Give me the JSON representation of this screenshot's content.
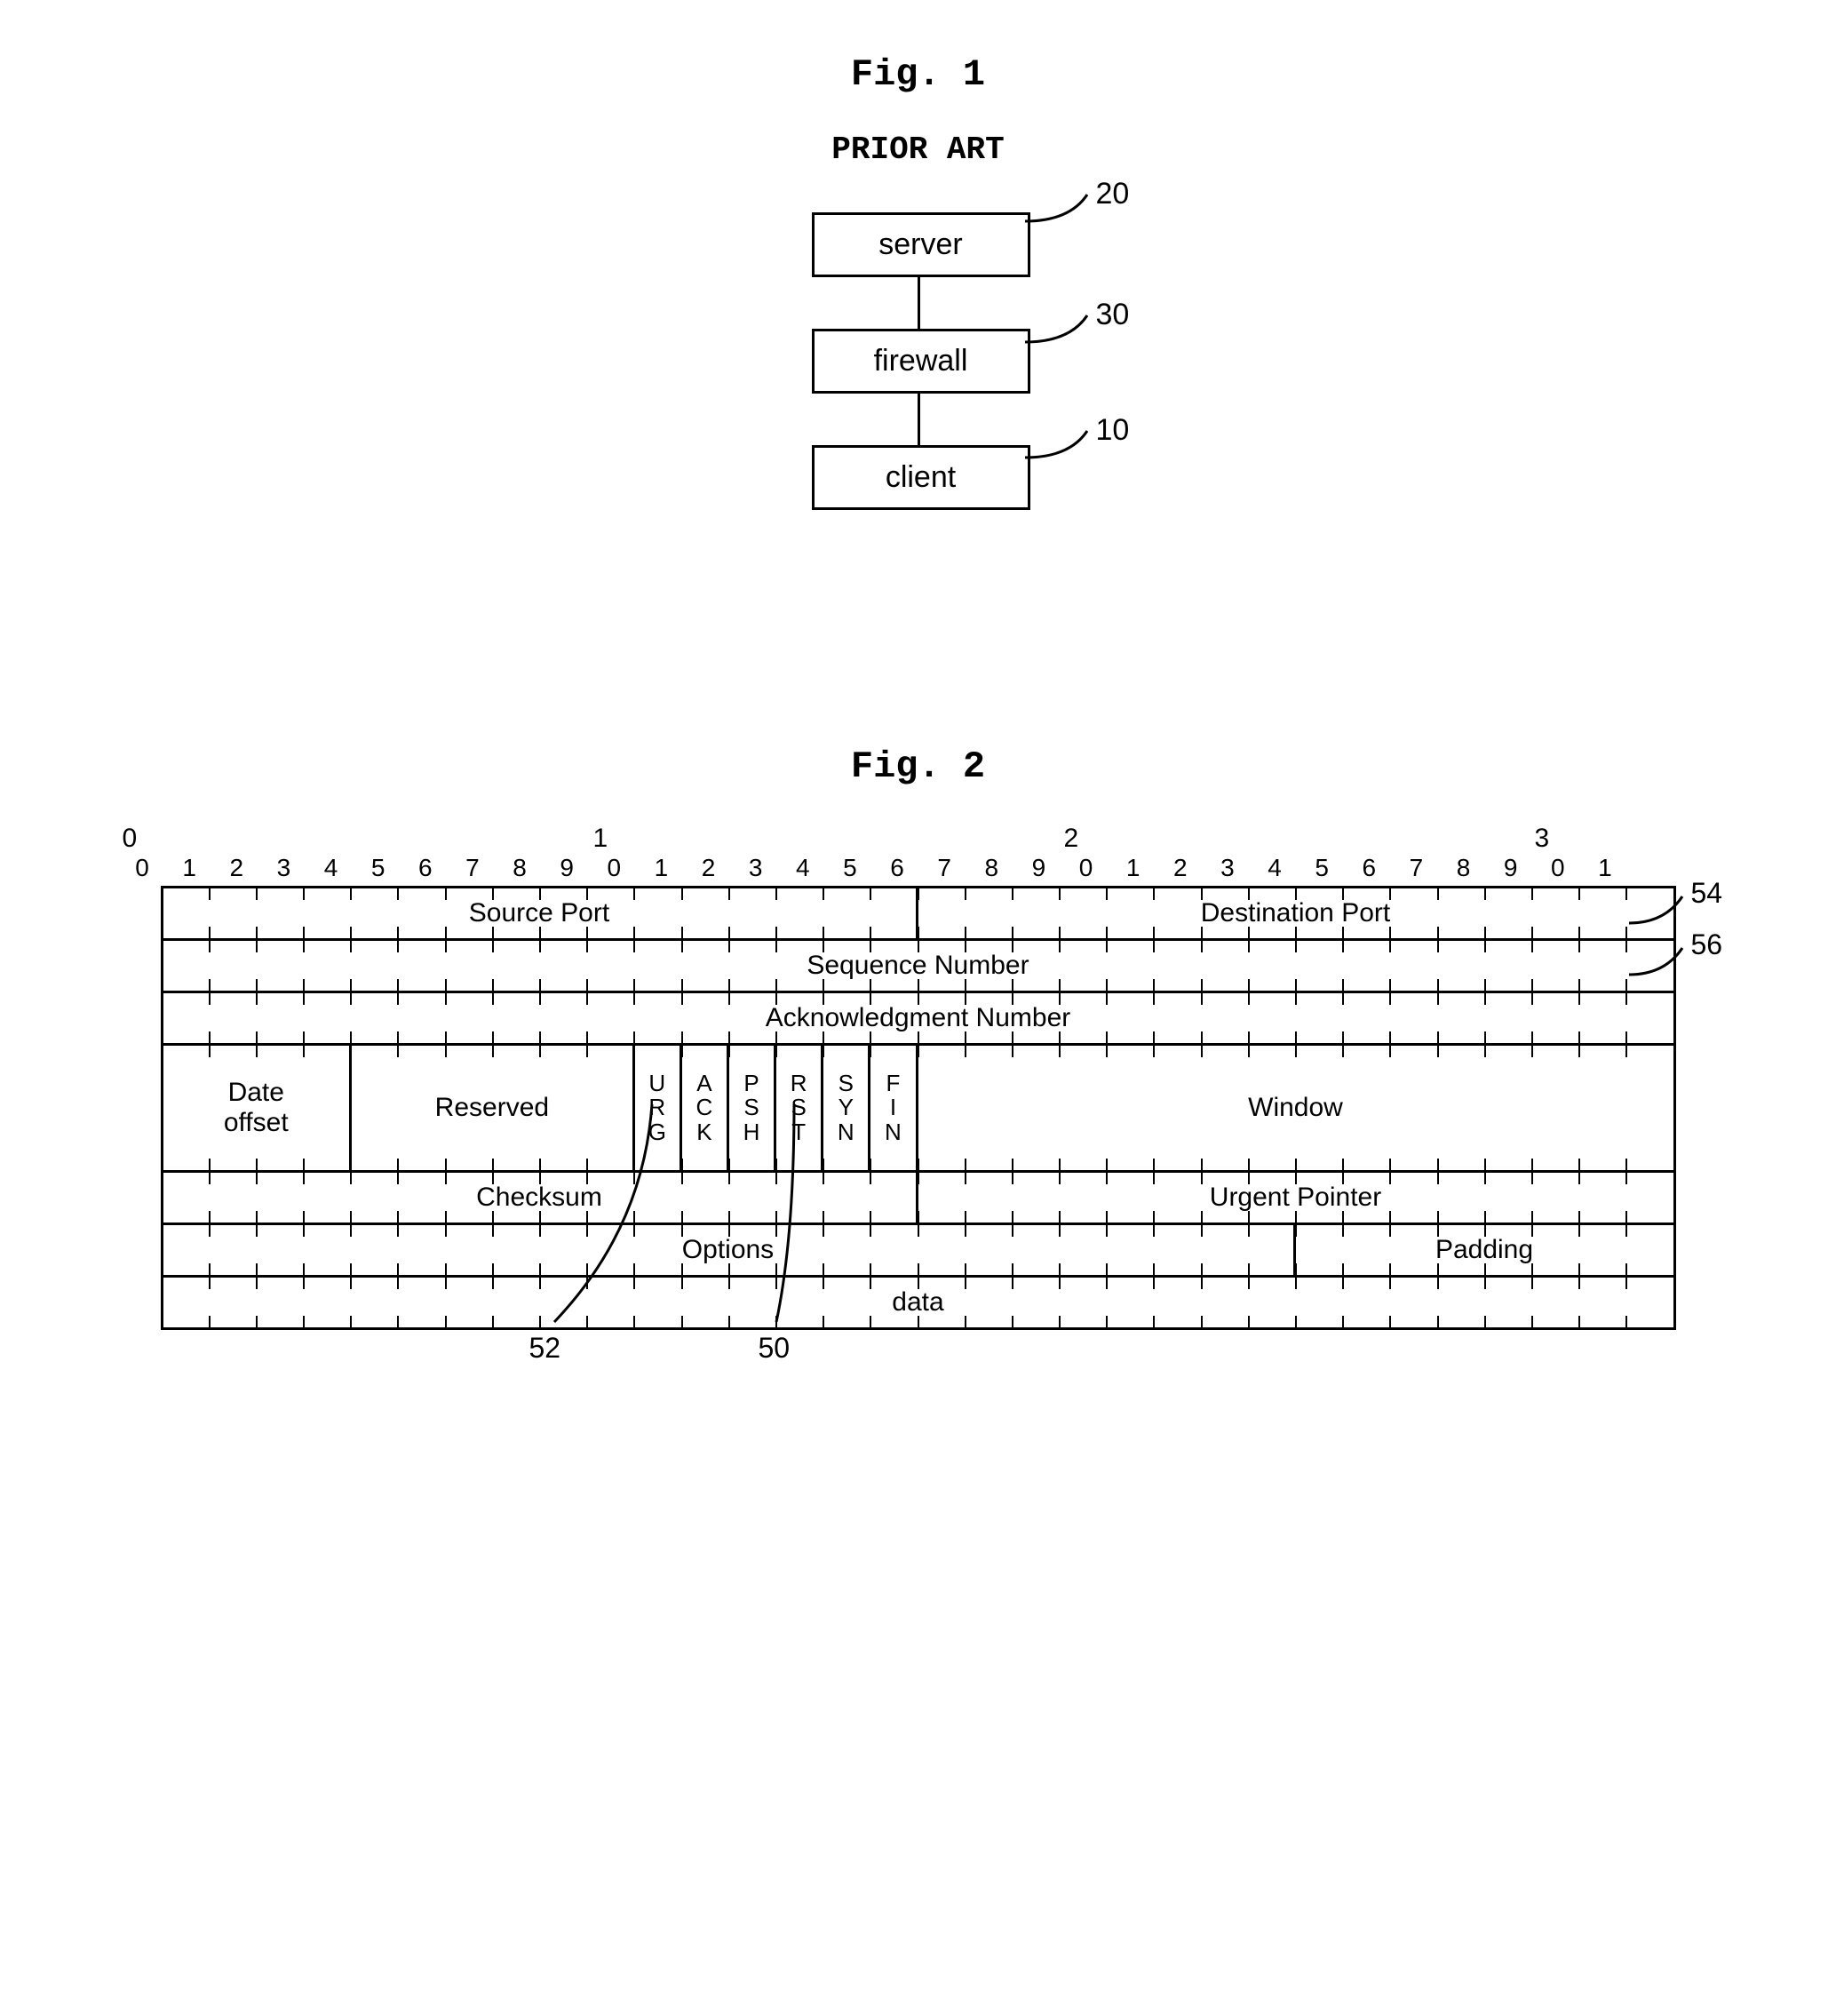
{
  "fig1": {
    "title": "Fig. 1",
    "subtitle": "PRIOR ART",
    "boxes": {
      "server": "server",
      "firewall": "firewall",
      "client": "client"
    },
    "refs": {
      "server": "20",
      "firewall": "30",
      "client": "10"
    }
  },
  "fig2": {
    "title": "Fig. 2",
    "bitscale_groups": [
      "0",
      "1",
      "2",
      "3"
    ],
    "bitscale_units": [
      "0",
      "1",
      "2",
      "3",
      "4",
      "5",
      "6",
      "7",
      "8",
      "9",
      "0",
      "1",
      "2",
      "3",
      "4",
      "5",
      "6",
      "7",
      "8",
      "9",
      "0",
      "1",
      "2",
      "3",
      "4",
      "5",
      "6",
      "7",
      "8",
      "9",
      "0",
      "1"
    ],
    "rows": {
      "r1": {
        "source_port": "Source Port",
        "dest_port": "Destination Port"
      },
      "r2": {
        "seq": "Sequence Number"
      },
      "r3": {
        "ack": "Acknowledgment Number"
      },
      "r4": {
        "data_offset": "Date\noffset",
        "reserved": "Reserved",
        "flags": {
          "urg": "URG",
          "ack": "ACK",
          "psh": "PSH",
          "rst": "RST",
          "syn": "SYN",
          "fin": "FIN"
        },
        "window": "Window"
      },
      "r5": {
        "checksum": "Checksum",
        "urgent": "Urgent Pointer"
      },
      "r6": {
        "options": "Options",
        "padding": "Padding"
      },
      "r7": {
        "data": "data"
      }
    },
    "refs": {
      "seq_row": "54",
      "ack_row": "56",
      "ack_flag": "52",
      "syn_flag": "50"
    }
  }
}
